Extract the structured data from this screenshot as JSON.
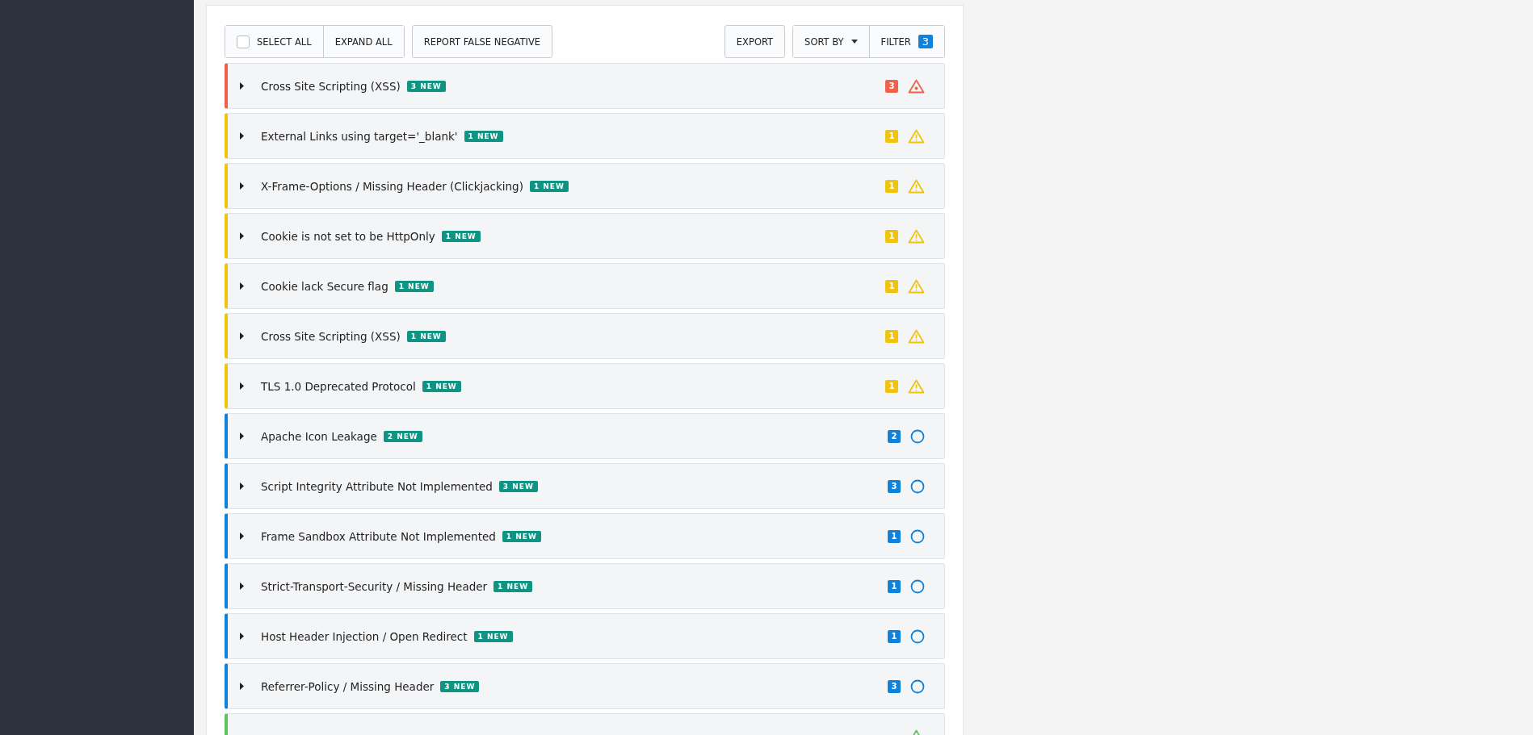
{
  "toolbar": {
    "select_all": {
      "label": "SELECT ALL",
      "checked": false
    },
    "expand_all": "EXPAND ALL",
    "report": "REPORT FALSE NEGATIVE",
    "export": "EXPORT",
    "sort_by": "SORT BY",
    "filter": {
      "label": "FILTER",
      "count": "3"
    }
  },
  "findings": [
    {
      "kind": "high",
      "title": "Cross Site Scripting (XSS)",
      "new": "3 NEW",
      "count": "3",
      "expanded": false
    },
    {
      "kind": "medium",
      "title": "External Links using target='_blank'",
      "new": "1 NEW",
      "count": "1",
      "expanded": false
    },
    {
      "kind": "medium",
      "title": "X-Frame-Options / Missing Header (Clickjacking)",
      "new": "1 NEW",
      "count": "1",
      "expanded": false
    },
    {
      "kind": "medium",
      "title": "Cookie is not set to be HttpOnly",
      "new": "1 NEW",
      "count": "1",
      "expanded": false
    },
    {
      "kind": "medium",
      "title": "Cookie lack Secure flag",
      "new": "1 NEW",
      "count": "1",
      "expanded": false
    },
    {
      "kind": "medium",
      "title": "Cross Site Scripting (XSS)",
      "new": "1 NEW",
      "count": "1",
      "expanded": false
    },
    {
      "kind": "medium",
      "title": "TLS 1.0 Deprecated Protocol",
      "new": "1 NEW",
      "count": "1",
      "expanded": false
    },
    {
      "kind": "low",
      "title": "Apache Icon Leakage",
      "new": "2 NEW",
      "count": "2",
      "expanded": false
    },
    {
      "kind": "low",
      "title": "Script Integrity Attribute Not Implemented",
      "new": "3 NEW",
      "count": "3",
      "expanded": false
    },
    {
      "kind": "low",
      "title": "Frame Sandbox Attribute Not Implemented",
      "new": "1 NEW",
      "count": "1",
      "expanded": false
    },
    {
      "kind": "low",
      "title": "Strict-Transport-Security / Missing Header",
      "new": "1 NEW",
      "count": "1",
      "expanded": false
    },
    {
      "kind": "low",
      "title": "Host Header Injection / Open Redirect",
      "new": "1 NEW",
      "count": "1",
      "expanded": false
    },
    {
      "kind": "low",
      "title": "Referrer-Policy / Missing Header",
      "new": "3 NEW",
      "count": "3",
      "expanded": false
    },
    {
      "kind": "info"
    }
  ]
}
